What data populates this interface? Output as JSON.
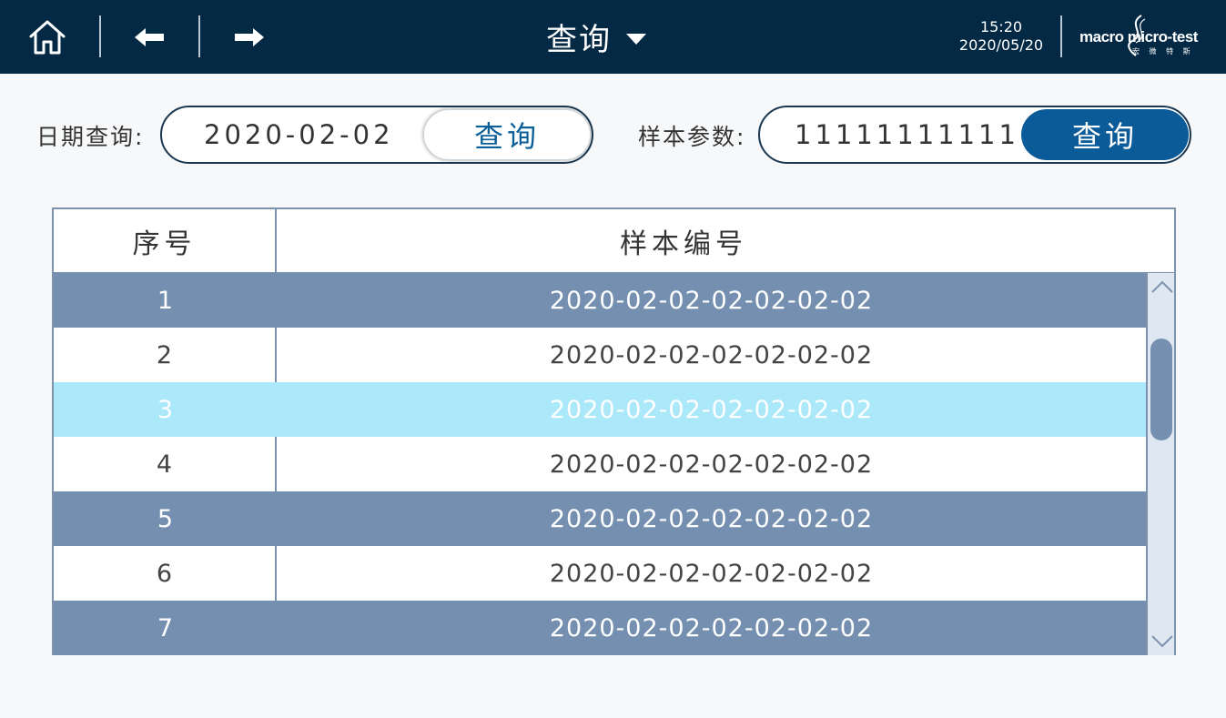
{
  "header": {
    "title": "查询",
    "time": "15:20",
    "date": "2020/05/20",
    "logo_text": "macro micro-test",
    "logo_sub": "宏 微 特 斯",
    "icons": {
      "home": "home-icon",
      "back": "arrow-left-icon",
      "forward": "arrow-right-icon",
      "dropdown": "caret-down-icon"
    }
  },
  "date_search": {
    "label": "日期查询:",
    "value": "2020-02-02",
    "button": "查询"
  },
  "sample_search": {
    "label": "样本参数:",
    "value": "11111111111",
    "button": "查询"
  },
  "table": {
    "columns": [
      "序号",
      "样本编号"
    ],
    "rows": [
      {
        "index": "1",
        "sample_id": "2020-02-02-02-02-02-02"
      },
      {
        "index": "2",
        "sample_id": "2020-02-02-02-02-02-02"
      },
      {
        "index": "3",
        "sample_id": "2020-02-02-02-02-02-02"
      },
      {
        "index": "4",
        "sample_id": "2020-02-02-02-02-02-02"
      },
      {
        "index": "5",
        "sample_id": "2020-02-02-02-02-02-02"
      },
      {
        "index": "6",
        "sample_id": "2020-02-02-02-02-02-02"
      },
      {
        "index": "7",
        "sample_id": "2020-02-02-02-02-02-02"
      }
    ],
    "selected_index": "3"
  },
  "colors": {
    "header_bg": "#032944",
    "row_blue": "#748faf",
    "row_selected": "#aae8fa",
    "button_dark": "#0a5b98",
    "button_text_light": "#0b5f98"
  }
}
